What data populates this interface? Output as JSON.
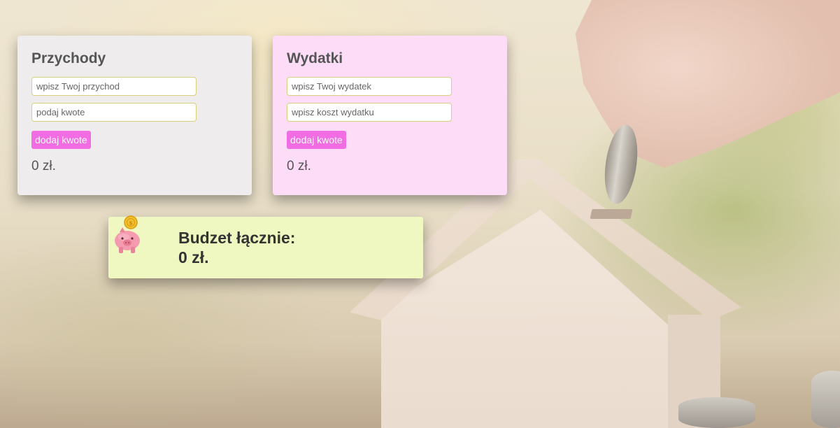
{
  "income": {
    "title": "Przychody",
    "name_placeholder": "wpisz Twoj przychod",
    "amount_placeholder": "podaj kwote",
    "add_button": "dodaj kwote",
    "total": "0 zł."
  },
  "expenses": {
    "title": "Wydatki",
    "name_placeholder": "wpisz Twoj wydatek",
    "amount_placeholder": "wpisz koszt wydatku",
    "add_button": "dodaj kwote",
    "total": "0 zł."
  },
  "budget": {
    "title": "Budzet łącznie:",
    "total": "0 zł.",
    "icon": "piggy-bank-icon"
  },
  "colors": {
    "income_card": "#eeeced",
    "expenses_card": "#fddcf7",
    "budget_box": "#eff8c0",
    "button": "#f26ce3",
    "input_border": "#d8d07a"
  }
}
